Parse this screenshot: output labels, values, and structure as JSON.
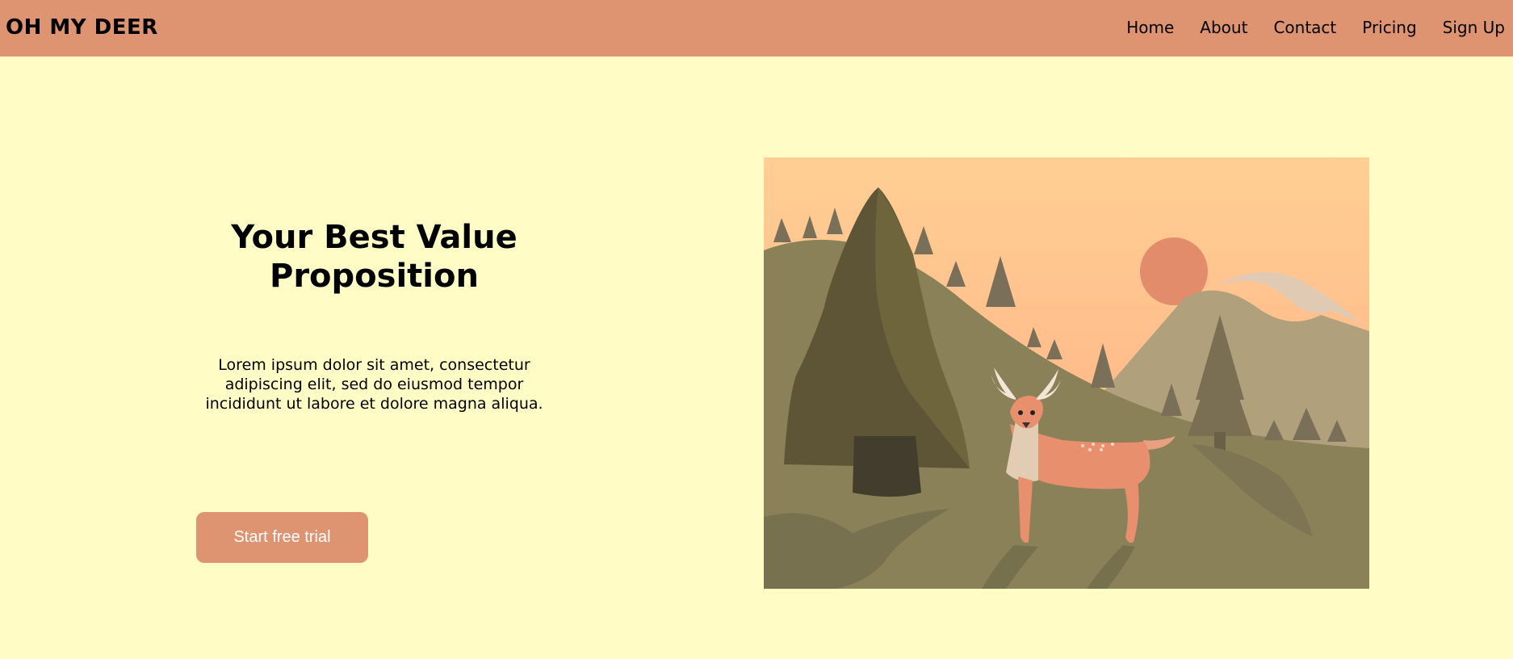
{
  "header": {
    "brand": "OH MY DEER",
    "nav": [
      {
        "label": "Home"
      },
      {
        "label": "About"
      },
      {
        "label": "Contact"
      },
      {
        "label": "Pricing"
      },
      {
        "label": "Sign Up"
      }
    ]
  },
  "hero": {
    "title_line1": "Your Best Value",
    "title_line2": "Proposition",
    "body_line1": "Lorem ipsum dolor sit amet, consectetur",
    "body_line2": "adipiscing elit, sed do eiusmod tempor",
    "body_line3": "incididunt ut labore et dolore magna aliqua.",
    "cta_label": "Start free trial"
  },
  "colors": {
    "background": "#fffdc5",
    "navbar": "#de9371",
    "button": "#de9371"
  },
  "illustration": {
    "subject": "deer-in-forest-illustration"
  }
}
